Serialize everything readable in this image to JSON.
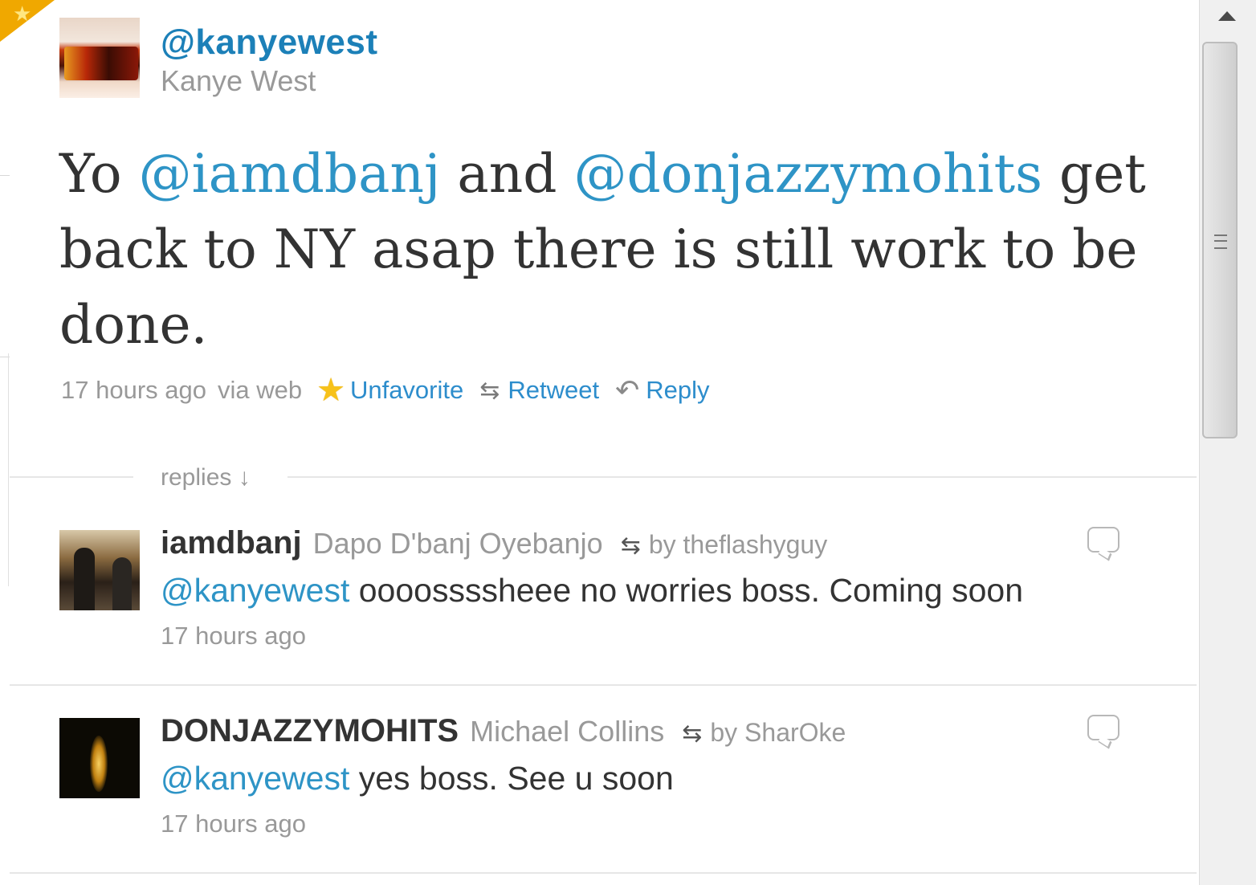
{
  "tweet": {
    "screen_name": "@kanyewest",
    "real_name": "Kanye West",
    "text_prefix": "Yo ",
    "mention_1": "@iamdbanj",
    "text_middle": " and ",
    "mention_2": "@donjazzymohits",
    "text_suffix": " get back to NY asap there is still work to be done.",
    "timestamp": "17 hours ago",
    "via": "via web",
    "unfavorite_label": "Unfavorite",
    "retweet_label": "Retweet",
    "reply_label": "Reply"
  },
  "replies_label": "replies ↓",
  "replies": [
    {
      "username": "iamdbanj",
      "real_name": "Dapo D'banj Oyebanjo",
      "retweeted_by": "by theflashyguy",
      "mention": "@kanyewest",
      "text": " oooossssheee no worries boss. Coming soon",
      "timestamp": "17 hours ago"
    },
    {
      "username": "DONJAZZYMOHITS",
      "real_name": "Michael Collins",
      "retweeted_by": "by SharOke",
      "mention": "@kanyewest",
      "text": " yes boss. See u soon",
      "timestamp": "17 hours ago"
    }
  ],
  "icons": {
    "favorite": "star-icon",
    "retweet": "retweet-icon",
    "reply": "reply-arrow-icon",
    "reply_bubble": "speech-bubble-icon"
  },
  "colors": {
    "link": "#2d8dcc",
    "text": "#333333",
    "muted": "#999999",
    "star": "#f7c21a"
  }
}
